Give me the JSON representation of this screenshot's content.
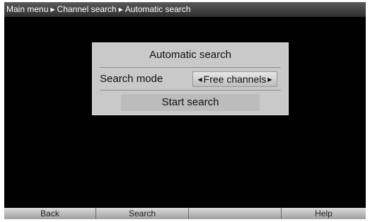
{
  "breadcrumb": {
    "items": [
      "Main menu",
      "Channel search",
      "Automatic search"
    ],
    "separator": "▶"
  },
  "dialog": {
    "title": "Automatic search",
    "search_mode_label": "Search mode",
    "search_mode_value": "Free channels",
    "arrow_left": "◀",
    "arrow_right": "▶",
    "start_button": "Start search"
  },
  "function_keys": [
    "Back",
    "Search",
    "",
    "Help"
  ],
  "colors": {
    "screen_background": "#000000",
    "dialog_background": "#c9c9c9",
    "button_background": "#bcbcbc"
  }
}
